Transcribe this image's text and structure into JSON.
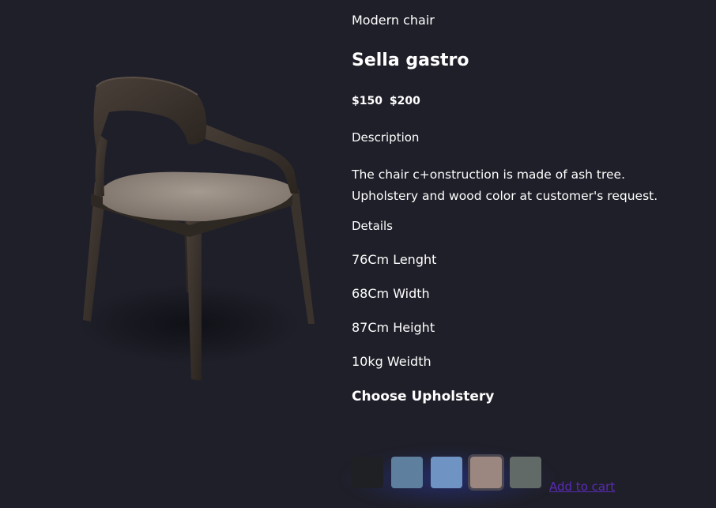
{
  "product": {
    "category": "Modern chair",
    "name": "Sella gastro",
    "price_current": "$150",
    "price_old": "$200",
    "description_label": "Description",
    "description": "The chair c+onstruction is made of ash tree. Upholstery and wood color at customer's request.",
    "details_label": "Details",
    "specs": [
      "76Cm Lenght",
      "68Cm Width",
      "87Cm Height",
      "10kg Weidth"
    ],
    "upholstery_label": "Choose Upholstery",
    "image_icon": "chair-image"
  },
  "swatches": [
    {
      "name": "black",
      "color": "#1f2024"
    },
    {
      "name": "denim-blue",
      "color": "#5f7f9e"
    },
    {
      "name": "light-blue",
      "color": "#6f94c4"
    },
    {
      "name": "beige",
      "color": "#9b8780"
    },
    {
      "name": "grey-green",
      "color": "#616a66"
    }
  ],
  "selected_swatch": "beige",
  "cart": {
    "add_label": "Add to cart"
  },
  "colors": {
    "background": "#1f1f29",
    "link": "#5b2bb7"
  }
}
